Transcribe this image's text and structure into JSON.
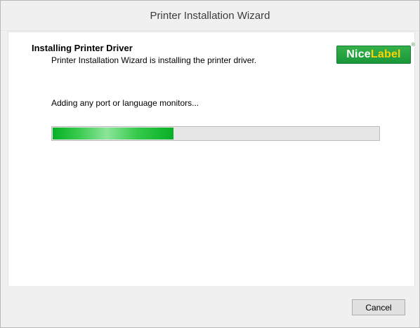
{
  "window": {
    "title": "Printer Installation Wizard"
  },
  "header": {
    "title": "Installing Printer Driver",
    "subtitle": "Printer Installation Wizard is installing the printer driver."
  },
  "logo": {
    "part1": "Nice",
    "part2": "Label",
    "mark": "®",
    "part1_color": "#ffffff",
    "part2_color": "#ffd200",
    "background": "#17963a"
  },
  "status": {
    "text": "Adding any port or language monitors...",
    "progress_fraction": 0.37,
    "progress_color": "#06b025"
  },
  "footer": {
    "cancel_label": "Cancel"
  }
}
